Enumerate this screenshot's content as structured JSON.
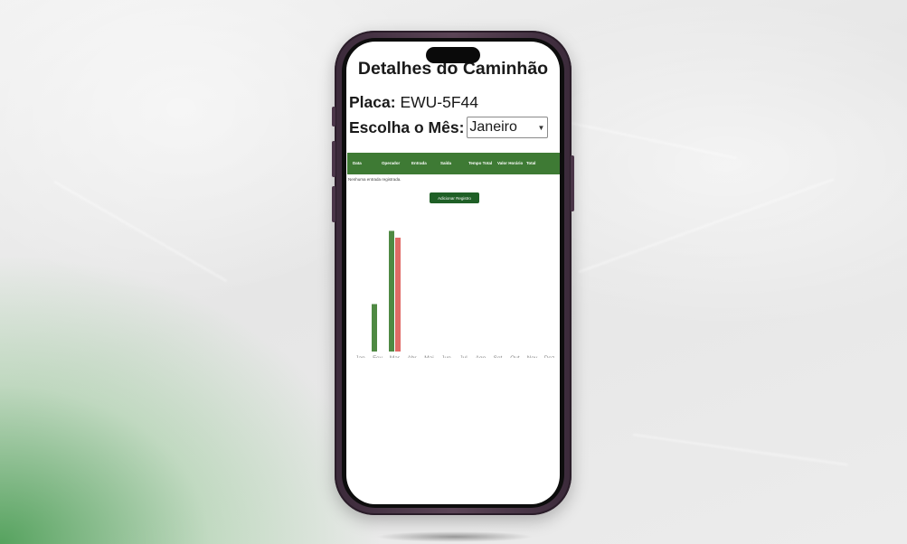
{
  "page": {
    "title": "Detalhes do Caminhão",
    "placa_label": "Placa:",
    "placa_value": "EWU-5F44",
    "mes_label": "Escolha o Mês:",
    "mes_selected": "Janeiro"
  },
  "table": {
    "columns": [
      "Data",
      "Operador",
      "Entrada",
      "Saída",
      "Tempo Total",
      "Valor Horário",
      "Total"
    ],
    "empty_message": "Nenhuma entrada registrada."
  },
  "actions": {
    "add_label": "Adicionar Registro"
  },
  "colors": {
    "header_green": "#3e7a34",
    "button_green": "#1f5f26",
    "series_green": "#4f8a43",
    "series_red": "#e06a66"
  },
  "chart_data": {
    "type": "bar",
    "categories": [
      "Jan",
      "Fev",
      "Mar",
      "Abr",
      "Mai",
      "Jun",
      "Jul",
      "Ago",
      "Set",
      "Out",
      "Nov",
      "Dez"
    ],
    "series": [
      {
        "values": [
          0,
          35,
          89,
          0,
          0,
          0,
          0,
          0,
          0,
          0,
          0,
          0
        ],
        "color": "#4f8a43"
      },
      {
        "values": [
          0,
          0,
          84,
          0,
          0,
          0,
          0,
          0,
          0,
          0,
          0,
          0
        ],
        "color": "#e06a66"
      }
    ],
    "ylim": [
      0,
      100
    ],
    "grid": false,
    "legend": "none"
  }
}
